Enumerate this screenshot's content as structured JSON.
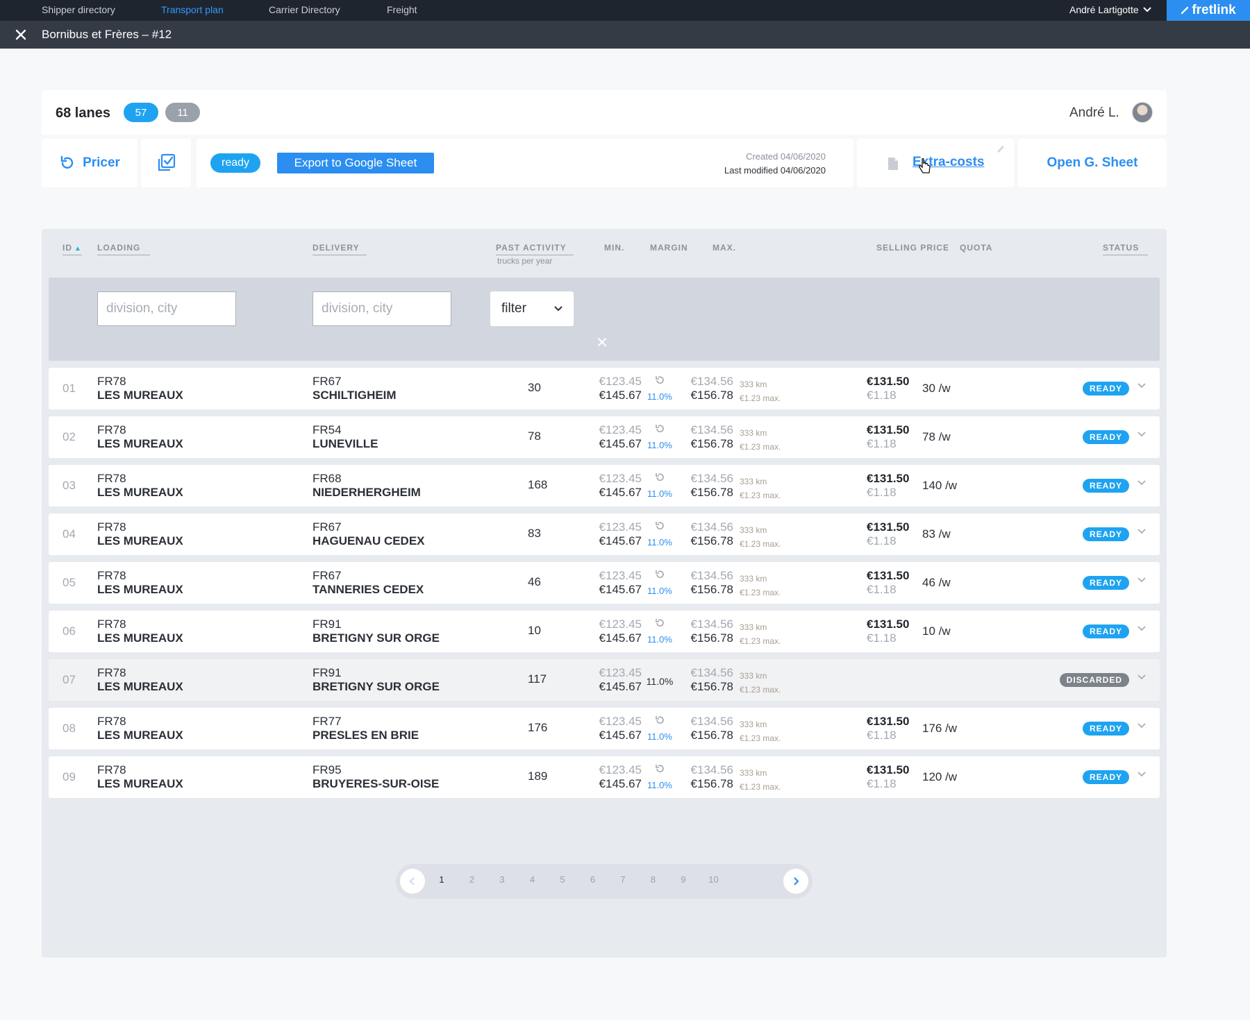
{
  "nav": {
    "items": [
      "Shipper directory",
      "Transport plan",
      "Carrier Directory",
      "Freight"
    ],
    "user": "André Lartigotte",
    "brand": "fretlink"
  },
  "titlebar": {
    "title": "Bornibus et Frères – #12"
  },
  "header": {
    "lanes": "68 lanes",
    "count_ready": "57",
    "count_other": "11",
    "owner": "André L."
  },
  "toolbar": {
    "pricer": "Pricer",
    "status": "ready",
    "export": "Export to Google Sheet",
    "created": "Created 04/06/2020",
    "modified": "Last modified 04/06/2020",
    "extra_costs": "Extra-costs",
    "open_sheet": "Open G. Sheet"
  },
  "table": {
    "headers": {
      "id": "ID",
      "loading": "LOADING",
      "delivery": "DELIVERY",
      "past": "PAST ACTIVITY",
      "past_sub": "trucks per year",
      "min": "MIN.",
      "margin": "MARGIN",
      "max": "MAX.",
      "selling": "SELLING PRICE",
      "quota": "QUOTA",
      "status": "STATUS"
    },
    "filters": {
      "loading_placeholder": "division, city",
      "delivery_placeholder": "division, city",
      "select": "filter"
    },
    "rows": [
      {
        "id": "01",
        "lcode": "FR78",
        "lcity": "LES MUREAUX",
        "dcode": "FR67",
        "dcity": "SCHILTIGHEIM",
        "past": "30",
        "min1": "€123.45",
        "min2": "€145.67",
        "margin": "11.0%",
        "max1": "€134.56",
        "max2": "€156.78",
        "km": "333 km",
        "kmmax": "€1.23 max.",
        "sell": "€131.50",
        "sellkm": "€1.18",
        "quota": "30 /w",
        "status": "READY"
      },
      {
        "id": "02",
        "lcode": "FR78",
        "lcity": "LES MUREAUX",
        "dcode": "FR54",
        "dcity": "LUNEVILLE",
        "past": "78",
        "min1": "€123.45",
        "min2": "€145.67",
        "margin": "11.0%",
        "max1": "€134.56",
        "max2": "€156.78",
        "km": "333 km",
        "kmmax": "€1.23 max.",
        "sell": "€131.50",
        "sellkm": "€1.18",
        "quota": "78 /w",
        "status": "READY"
      },
      {
        "id": "03",
        "lcode": "FR78",
        "lcity": "LES MUREAUX",
        "dcode": "FR68",
        "dcity": "NIEDERHERGHEIM",
        "past": "168",
        "min1": "€123.45",
        "min2": "€145.67",
        "margin": "11.0%",
        "max1": "€134.56",
        "max2": "€156.78",
        "km": "333 km",
        "kmmax": "€1.23 max.",
        "sell": "€131.50",
        "sellkm": "€1.18",
        "quota": "140 /w",
        "status": "READY"
      },
      {
        "id": "04",
        "lcode": "FR78",
        "lcity": "LES MUREAUX",
        "dcode": "FR67",
        "dcity": "HAGUENAU CEDEX",
        "past": "83",
        "min1": "€123.45",
        "min2": "€145.67",
        "margin": "11.0%",
        "max1": "€134.56",
        "max2": "€156.78",
        "km": "333 km",
        "kmmax": "€1.23 max.",
        "sell": "€131.50",
        "sellkm": "€1.18",
        "quota": "83 /w",
        "status": "READY"
      },
      {
        "id": "05",
        "lcode": "FR78",
        "lcity": "LES MUREAUX",
        "dcode": "FR67",
        "dcity": "TANNERIES CEDEX",
        "past": "46",
        "min1": "€123.45",
        "min2": "€145.67",
        "margin": "11.0%",
        "max1": "€134.56",
        "max2": "€156.78",
        "km": "333 km",
        "kmmax": "€1.23 max.",
        "sell": "€131.50",
        "sellkm": "€1.18",
        "quota": "46 /w",
        "status": "READY"
      },
      {
        "id": "06",
        "lcode": "FR78",
        "lcity": "LES MUREAUX",
        "dcode": "FR91",
        "dcity": "BRETIGNY SUR ORGE",
        "past": "10",
        "min1": "€123.45",
        "min2": "€145.67",
        "margin": "11.0%",
        "max1": "€134.56",
        "max2": "€156.78",
        "km": "333 km",
        "kmmax": "€1.23 max.",
        "sell": "€131.50",
        "sellkm": "€1.18",
        "quota": "10 /w",
        "status": "READY"
      },
      {
        "id": "07",
        "lcode": "FR78",
        "lcity": "LES MUREAUX",
        "dcode": "FR91",
        "dcity": "BRETIGNY SUR ORGE",
        "past": "117",
        "min1": "€123.45",
        "min2": "€145.67",
        "margin": "11.0%",
        "max1": "€134.56",
        "max2": "€156.78",
        "km": "333 km",
        "kmmax": "€1.23 max.",
        "sell": "",
        "sellkm": "",
        "quota": "",
        "status": "DISCARDED"
      },
      {
        "id": "08",
        "lcode": "FR78",
        "lcity": "LES MUREAUX",
        "dcode": "FR77",
        "dcity": "PRESLES EN BRIE",
        "past": "176",
        "min1": "€123.45",
        "min2": "€145.67",
        "margin": "11.0%",
        "max1": "€134.56",
        "max2": "€156.78",
        "km": "333 km",
        "kmmax": "€1.23 max.",
        "sell": "€131.50",
        "sellkm": "€1.18",
        "quota": "176 /w",
        "status": "READY"
      },
      {
        "id": "09",
        "lcode": "FR78",
        "lcity": "LES MUREAUX",
        "dcode": "FR95",
        "dcity": "BRUYERES-SUR-OISE",
        "past": "189",
        "min1": "€123.45",
        "min2": "€145.67",
        "margin": "11.0%",
        "max1": "€134.56",
        "max2": "€156.78",
        "km": "333 km",
        "kmmax": "€1.23 max.",
        "sell": "€131.50",
        "sellkm": "€1.18",
        "quota": "120 /w",
        "status": "READY"
      }
    ]
  },
  "pagination": {
    "pages": [
      "1",
      "2",
      "3",
      "4",
      "5",
      "6",
      "7",
      "8",
      "9",
      "10"
    ],
    "current": "1"
  },
  "colors": {
    "accent": "#2b8ef0",
    "ready": "#1fa3f0",
    "discarded": "#7d838b"
  }
}
